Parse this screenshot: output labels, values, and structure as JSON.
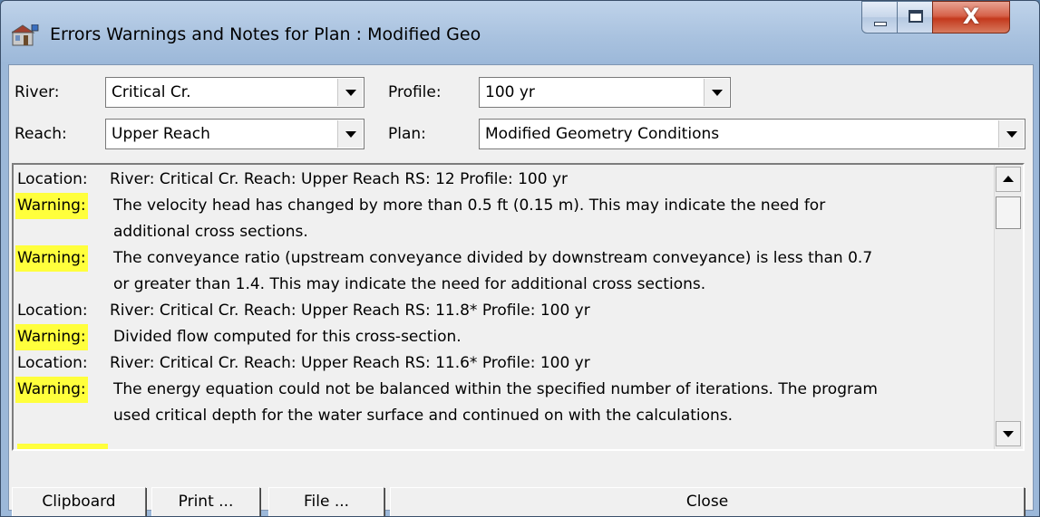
{
  "window": {
    "title": "Errors Warnings and Notes for Plan : Modified Geo",
    "controls": {
      "close_glyph": "X"
    }
  },
  "filters": {
    "river_label": "River:",
    "river_value": "Critical Cr.",
    "reach_label": "Reach:",
    "reach_value": "Upper Reach",
    "profile_label": "Profile:",
    "profile_value": "100 yr",
    "plan_label": "Plan:",
    "plan_value": "Modified Geometry Conditions"
  },
  "messages": [
    {
      "kind": "location",
      "key": "Location:",
      "text": "River: Critical Cr.  Reach: Upper Reach    RS: 12    Profile: 100 yr"
    },
    {
      "kind": "warning",
      "key": "Warning:",
      "text": "The velocity head has changed by more than 0.5 ft (0.15 m).  This may indicate the need for"
    },
    {
      "kind": "continuation",
      "key": "",
      "text": "additional cross sections."
    },
    {
      "kind": "warning",
      "key": "Warning:",
      "text": "The conveyance ratio (upstream conveyance divided by downstream conveyance) is less than 0.7"
    },
    {
      "kind": "continuation",
      "key": "",
      "text": "or greater than 1.4.  This may indicate the need for additional cross sections."
    },
    {
      "kind": "location",
      "key": "Location:",
      "text": "River: Critical Cr.  Reach: Upper Reach    RS: 11.8*    Profile: 100 yr"
    },
    {
      "kind": "warning",
      "key": "Warning:",
      "text": "Divided flow computed for this cross-section."
    },
    {
      "kind": "location",
      "key": "Location:",
      "text": "River: Critical Cr.  Reach: Upper Reach    RS: 11.6*    Profile: 100 yr"
    },
    {
      "kind": "warning",
      "key": "Warning:",
      "text": "The energy equation could not be balanced within the specified number of iterations.  The program"
    },
    {
      "kind": "continuation",
      "key": "",
      "text": "used critical depth for the water surface and continued on with the calculations."
    }
  ],
  "buttons": {
    "clipboard": "Clipboard",
    "print": "Print ...",
    "file": "File ...",
    "close": "Close"
  },
  "colors": {
    "warning_highlight": "#ffff3c",
    "dialog_background": "#f0f0f0"
  }
}
